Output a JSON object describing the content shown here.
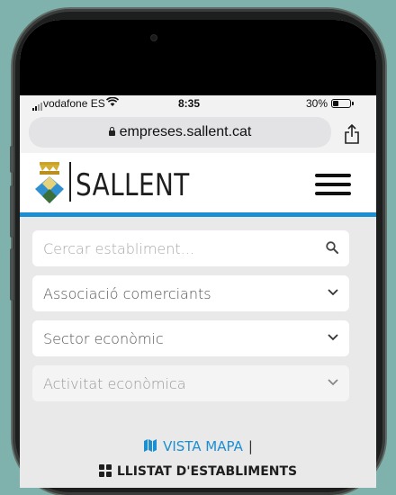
{
  "status_bar": {
    "carrier": "vodafone ES",
    "time": "8:35",
    "battery": "30%"
  },
  "browser": {
    "url": "empreses.sallent.cat"
  },
  "header": {
    "logo_text": "SALLENT"
  },
  "filters": {
    "search_placeholder": "Cercar establiment...",
    "association_label": "Associació comerciants",
    "sector_label": "Sector econòmic",
    "activity_label": "Activitat econòmica"
  },
  "views": {
    "map_label": "VISTA MAPA",
    "separator": "|",
    "list_label": "LLISTAT D'ESTABLIMENTS"
  },
  "colors": {
    "accent": "#1b8fd2",
    "background": "#7fb2ad"
  }
}
